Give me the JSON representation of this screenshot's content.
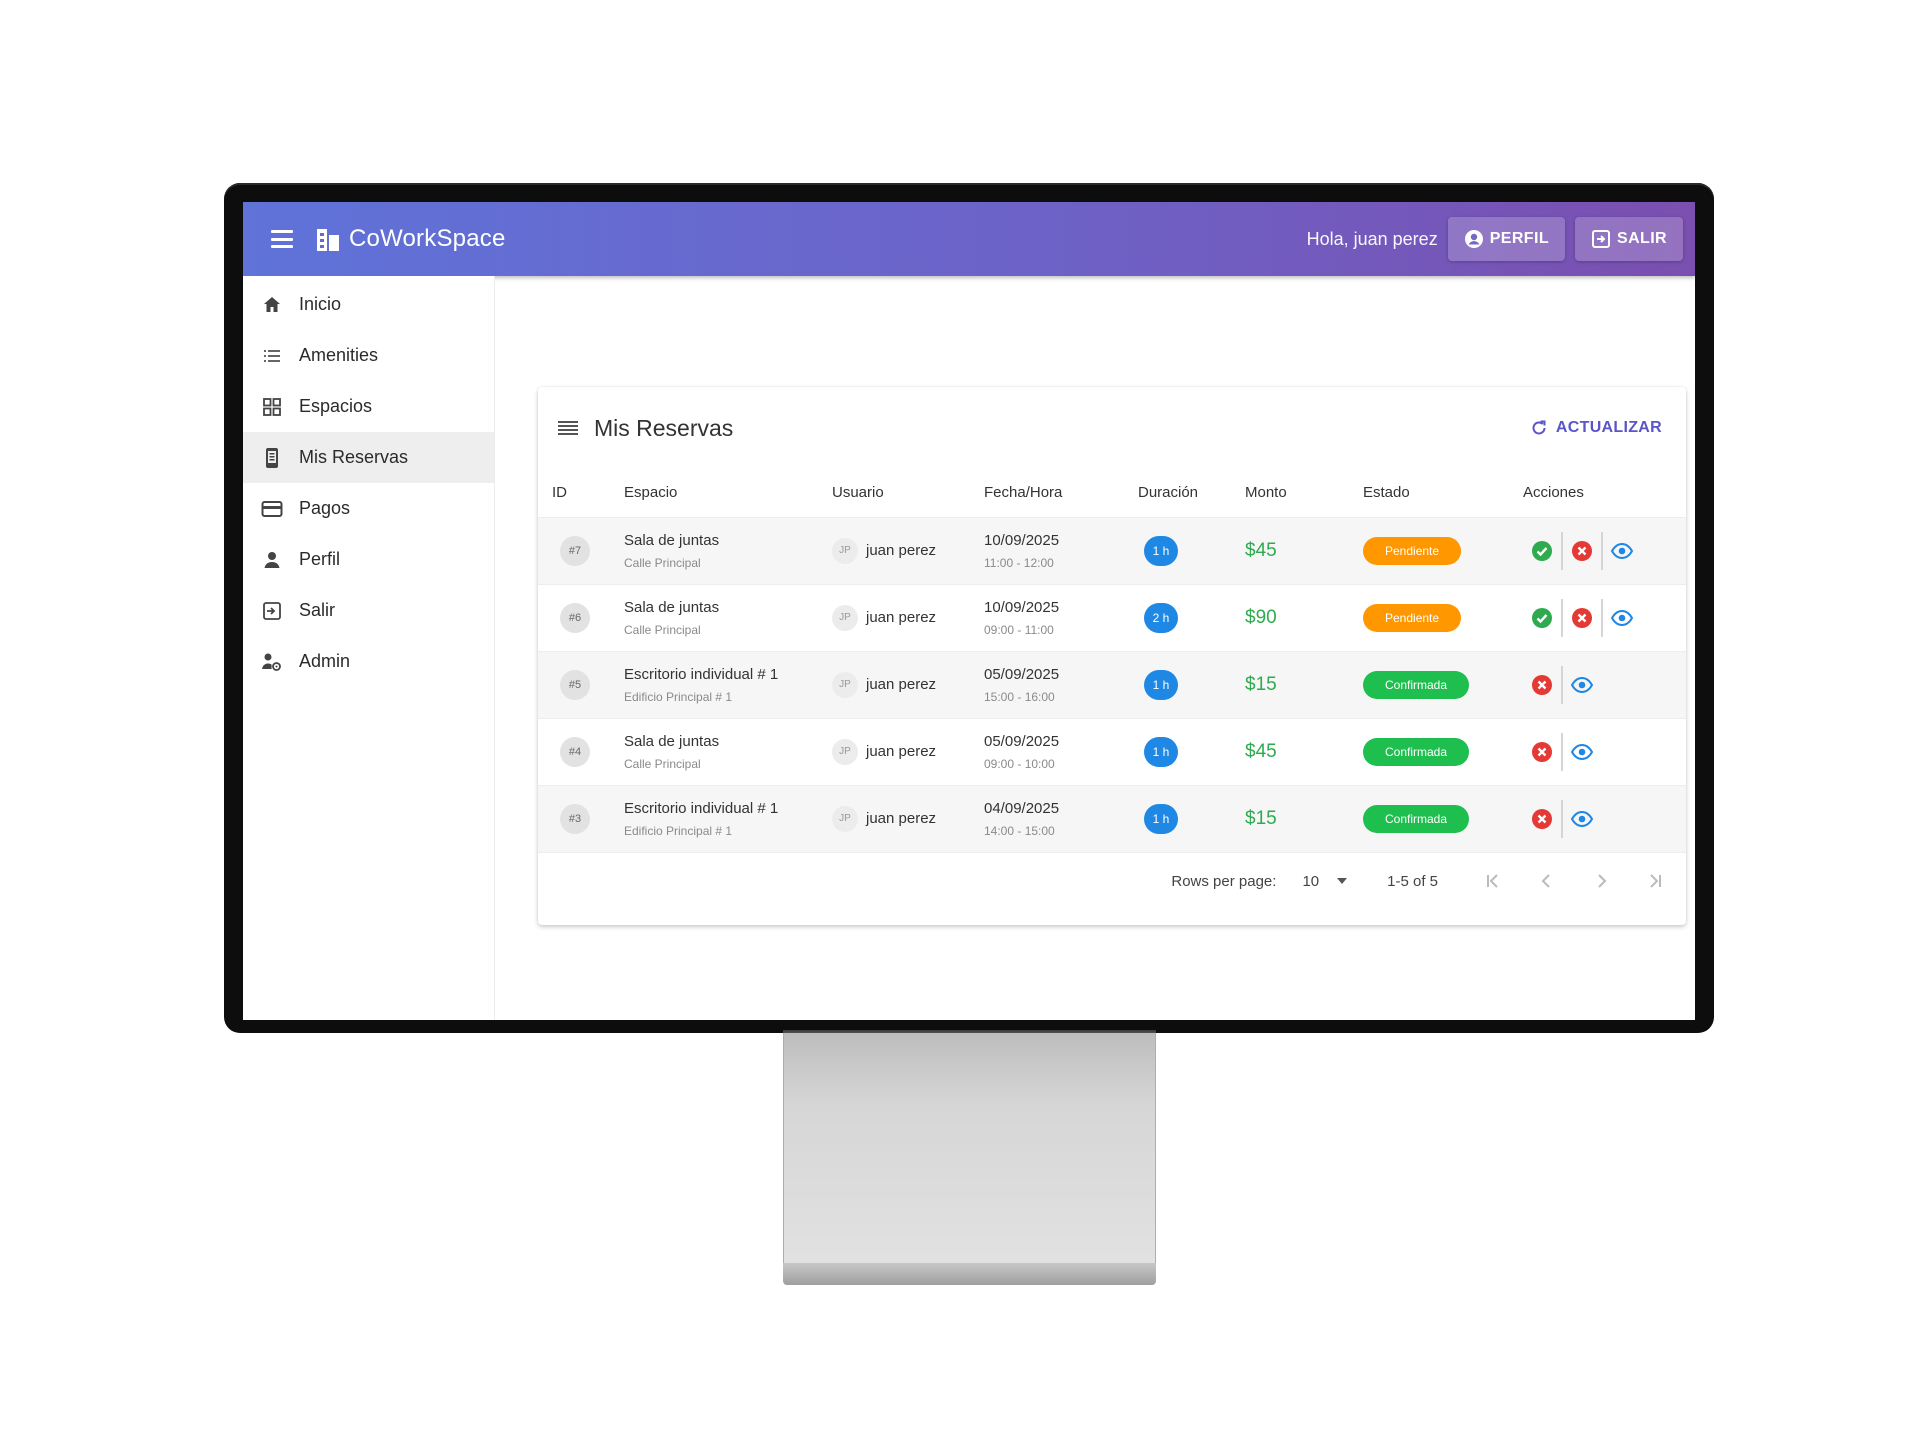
{
  "appbar": {
    "title": "CoWorkSpace",
    "greeting": "Hola, juan perez",
    "profile_label": "PERFIL",
    "logout_label": "SALIR"
  },
  "sidebar": {
    "items": [
      {
        "label": "Inicio",
        "icon": "home-icon"
      },
      {
        "label": "Amenities",
        "icon": "list-icon"
      },
      {
        "label": "Espacios",
        "icon": "grid-icon"
      },
      {
        "label": "Mis Reservas",
        "icon": "phone-icon",
        "active": true
      },
      {
        "label": "Pagos",
        "icon": "credit-card-icon"
      },
      {
        "label": "Perfil",
        "icon": "person-icon"
      },
      {
        "label": "Salir",
        "icon": "logout-icon"
      },
      {
        "label": "Admin",
        "icon": "admin-icon"
      }
    ]
  },
  "card": {
    "title": "Mis Reservas",
    "refresh_label": "ACTUALIZAR"
  },
  "table": {
    "headers": [
      "ID",
      "Espacio",
      "Usuario",
      "Fecha/Hora",
      "Duración",
      "Monto",
      "Estado",
      "Acciones"
    ],
    "rows": [
      {
        "id": "#7",
        "space": "Sala de juntas",
        "address": "Calle Principal",
        "initials": "JP",
        "user": "juan perez",
        "date": "10/09/2025",
        "time": "11:00 - 12:00",
        "duration": "1 h",
        "amount": "$45",
        "status": "Pendiente"
      },
      {
        "id": "#6",
        "space": "Sala de juntas",
        "address": "Calle Principal",
        "initials": "JP",
        "user": "juan perez",
        "date": "10/09/2025",
        "time": "09:00 - 11:00",
        "duration": "2 h",
        "amount": "$90",
        "status": "Pendiente"
      },
      {
        "id": "#5",
        "space": "Escritorio individual # 1",
        "address": "Edificio Principal # 1",
        "initials": "JP",
        "user": "juan perez",
        "date": "05/09/2025",
        "time": "15:00 - 16:00",
        "duration": "1 h",
        "amount": "$15",
        "status": "Confirmada"
      },
      {
        "id": "#4",
        "space": "Sala de juntas",
        "address": "Calle Principal",
        "initials": "JP",
        "user": "juan perez",
        "date": "05/09/2025",
        "time": "09:00 - 10:00",
        "duration": "1 h",
        "amount": "$45",
        "status": "Confirmada"
      },
      {
        "id": "#3",
        "space": "Escritorio individual # 1",
        "address": "Edificio Principal # 1",
        "initials": "JP",
        "user": "juan perez",
        "date": "04/09/2025",
        "time": "14:00 - 15:00",
        "duration": "1 h",
        "amount": "$15",
        "status": "Confirmada"
      }
    ]
  },
  "pagination": {
    "rows_per_page_label": "Rows per page:",
    "rows_per_page": "10",
    "range": "1-5 of 5"
  },
  "colors": {
    "appbar_start": "#5f73d9",
    "appbar_end": "#7a4fb0",
    "pending": "#ff9800",
    "confirmed": "#1fbf4f",
    "duration_chip": "#1f88e5",
    "amount": "#2eaa4f",
    "accept": "#2eaa4f",
    "cancel": "#e53935",
    "view": "#1f88e5"
  }
}
